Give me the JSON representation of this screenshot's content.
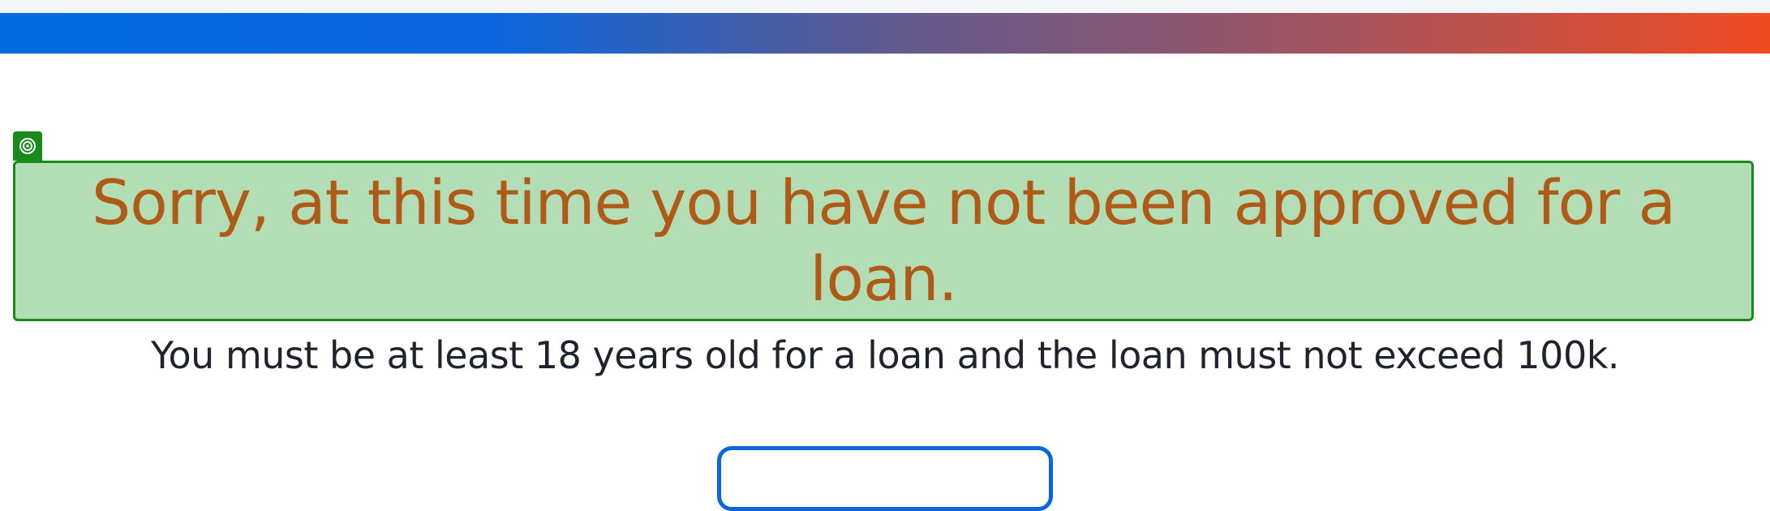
{
  "colors": {
    "gradient_start": "#0069e0",
    "gradient_end": "#f04b22",
    "highlight_border": "#1a8a1a",
    "highlight_fill": "#b3ddb5",
    "headline_text": "#b05a17",
    "body_text": "#1f232b",
    "button_border": "#0a66df"
  },
  "result": {
    "headline": "Sorry, at this time you have not been approved for a loan.",
    "detail": "You must be at least 18 years old for a loan and the loan must not exceed 100k."
  },
  "highlight": {
    "badge_icon": "target-icon"
  },
  "actions": {
    "primary_button_label": ""
  }
}
